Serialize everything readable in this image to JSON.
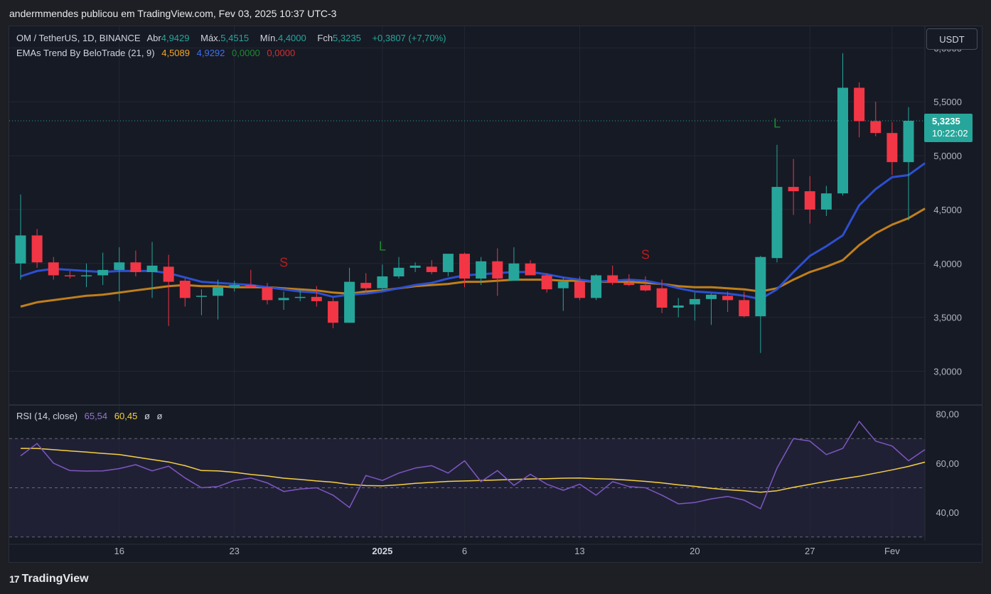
{
  "header": {
    "publish_text": "andermmendes publicou em TradingView.com, Fev 03, 2025 10:37 UTC-3"
  },
  "legend": {
    "symbol": "OM / TetherUS, 1D, BINANCE",
    "open_label": "Abr",
    "open_value": "4,9429",
    "high_label": "Máx.",
    "high_value": "5,4515",
    "low_label": "Mín.",
    "low_value": "4,4000",
    "close_label": "Fch",
    "close_value": "5,3235",
    "change": "+0,3807 (+7,70%)",
    "indicator_name": "EMAs Trend By BeloTrade (21, 9)",
    "ema21_value": "4,5089",
    "ema9_value": "4,9292",
    "val3": "0,0000",
    "val4": "0,0000"
  },
  "rsi_legend": {
    "name": "RSI (14, close)",
    "rsi_value": "65,54",
    "ma_value": "60,45",
    "sym1": "ø",
    "sym2": "ø"
  },
  "currency_button": "USDT",
  "price_label": {
    "price": "5,3235",
    "countdown": "10:22:02"
  },
  "footer": {
    "logo_mark": "17",
    "brand": "TradingView"
  },
  "colors": {
    "up": "#26a69a",
    "down": "#f23645",
    "ema9": "#2d4fcf",
    "ema21": "#c07f1b",
    "rsi": "#7e57c2",
    "rsi_ma": "#f5d142",
    "bg": "#161a25"
  },
  "chart_data": [
    {
      "type": "candlestick",
      "title": "OM / TetherUS, 1D, BINANCE",
      "y_ticks": [
        "6,0000",
        "5,5000",
        "5,0000",
        "4,5000",
        "4,0000",
        "3,5000",
        "3,0000"
      ],
      "y_tick_values": [
        6.0,
        5.5,
        5.0,
        4.5,
        4.0,
        3.5,
        3.0
      ],
      "ylim": [
        2.72,
        6.2
      ],
      "x_ticks": [
        {
          "label": "16",
          "index": 6,
          "bold": false
        },
        {
          "label": "23",
          "index": 13,
          "bold": false
        },
        {
          "label": "2025",
          "index": 22,
          "bold": true
        },
        {
          "label": "6",
          "index": 27,
          "bold": false
        },
        {
          "label": "13",
          "index": 34,
          "bold": false
        },
        {
          "label": "20",
          "index": 41,
          "bold": false
        },
        {
          "label": "27",
          "index": 48,
          "bold": false
        },
        {
          "label": "Fev",
          "index": 53,
          "bold": false
        }
      ],
      "candles": [
        {
          "o": 4.0,
          "h": 4.64,
          "l": 3.85,
          "c": 4.26
        },
        {
          "o": 4.26,
          "h": 4.32,
          "l": 3.96,
          "c": 4.01
        },
        {
          "o": 4.01,
          "h": 4.06,
          "l": 3.85,
          "c": 3.89
        },
        {
          "o": 3.89,
          "h": 3.93,
          "l": 3.86,
          "c": 3.88
        },
        {
          "o": 3.88,
          "h": 4.0,
          "l": 3.78,
          "c": 3.89
        },
        {
          "o": 3.89,
          "h": 4.1,
          "l": 3.8,
          "c": 3.94
        },
        {
          "o": 3.94,
          "h": 4.15,
          "l": 3.65,
          "c": 4.01
        },
        {
          "o": 4.01,
          "h": 4.12,
          "l": 3.88,
          "c": 3.92
        },
        {
          "o": 3.92,
          "h": 4.2,
          "l": 3.68,
          "c": 3.98
        },
        {
          "o": 3.97,
          "h": 4.08,
          "l": 3.42,
          "c": 3.83
        },
        {
          "o": 3.84,
          "h": 3.86,
          "l": 3.6,
          "c": 3.68
        },
        {
          "o": 3.69,
          "h": 3.76,
          "l": 3.52,
          "c": 3.7
        },
        {
          "o": 3.7,
          "h": 3.85,
          "l": 3.48,
          "c": 3.78
        },
        {
          "o": 3.78,
          "h": 3.84,
          "l": 3.74,
          "c": 3.8
        },
        {
          "o": 3.8,
          "h": 3.94,
          "l": 3.77,
          "c": 3.78
        },
        {
          "o": 3.78,
          "h": 3.82,
          "l": 3.62,
          "c": 3.66
        },
        {
          "o": 3.66,
          "h": 3.74,
          "l": 3.57,
          "c": 3.68
        },
        {
          "o": 3.68,
          "h": 3.76,
          "l": 3.65,
          "c": 3.69
        },
        {
          "o": 3.69,
          "h": 3.79,
          "l": 3.6,
          "c": 3.65
        },
        {
          "o": 3.65,
          "h": 3.68,
          "l": 3.4,
          "c": 3.45
        },
        {
          "o": 3.45,
          "h": 3.96,
          "l": 3.45,
          "c": 3.83
        },
        {
          "o": 3.82,
          "h": 3.91,
          "l": 3.73,
          "c": 3.77
        },
        {
          "o": 3.77,
          "h": 3.99,
          "l": 3.75,
          "c": 3.88
        },
        {
          "o": 3.88,
          "h": 4.06,
          "l": 3.86,
          "c": 3.96
        },
        {
          "o": 3.96,
          "h": 4.01,
          "l": 3.92,
          "c": 3.98
        },
        {
          "o": 3.97,
          "h": 4.03,
          "l": 3.9,
          "c": 3.92
        },
        {
          "o": 3.92,
          "h": 4.09,
          "l": 3.88,
          "c": 4.09
        },
        {
          "o": 4.09,
          "h": 4.1,
          "l": 3.78,
          "c": 3.86
        },
        {
          "o": 3.86,
          "h": 4.06,
          "l": 3.8,
          "c": 4.02
        },
        {
          "o": 4.02,
          "h": 4.14,
          "l": 3.7,
          "c": 3.86
        },
        {
          "o": 3.84,
          "h": 4.15,
          "l": 3.84,
          "c": 4.0
        },
        {
          "o": 4.0,
          "h": 4.03,
          "l": 3.89,
          "c": 3.89
        },
        {
          "o": 3.89,
          "h": 3.91,
          "l": 3.73,
          "c": 3.76
        },
        {
          "o": 3.77,
          "h": 3.87,
          "l": 3.56,
          "c": 3.83
        },
        {
          "o": 3.83,
          "h": 3.88,
          "l": 3.66,
          "c": 3.68
        },
        {
          "o": 3.68,
          "h": 3.9,
          "l": 3.66,
          "c": 3.89
        },
        {
          "o": 3.89,
          "h": 3.98,
          "l": 3.8,
          "c": 3.82
        },
        {
          "o": 3.82,
          "h": 3.9,
          "l": 3.79,
          "c": 3.8
        },
        {
          "o": 3.8,
          "h": 3.88,
          "l": 3.74,
          "c": 3.75
        },
        {
          "o": 3.77,
          "h": 3.85,
          "l": 3.54,
          "c": 3.59
        },
        {
          "o": 3.59,
          "h": 3.68,
          "l": 3.5,
          "c": 3.61
        },
        {
          "o": 3.62,
          "h": 3.73,
          "l": 3.47,
          "c": 3.67
        },
        {
          "o": 3.67,
          "h": 3.72,
          "l": 3.43,
          "c": 3.71
        },
        {
          "o": 3.7,
          "h": 3.74,
          "l": 3.55,
          "c": 3.66
        },
        {
          "o": 3.66,
          "h": 3.74,
          "l": 3.5,
          "c": 3.51
        },
        {
          "o": 3.51,
          "h": 4.07,
          "l": 3.17,
          "c": 4.06
        },
        {
          "o": 4.05,
          "h": 5.1,
          "l": 4.01,
          "c": 4.71
        },
        {
          "o": 4.71,
          "h": 4.97,
          "l": 4.45,
          "c": 4.67
        },
        {
          "o": 4.67,
          "h": 4.81,
          "l": 4.37,
          "c": 4.5
        },
        {
          "o": 4.5,
          "h": 4.72,
          "l": 4.44,
          "c": 4.65
        },
        {
          "o": 4.65,
          "h": 5.95,
          "l": 4.63,
          "c": 5.63
        },
        {
          "o": 5.63,
          "h": 5.68,
          "l": 5.17,
          "c": 5.32
        },
        {
          "o": 5.32,
          "h": 5.5,
          "l": 5.18,
          "c": 5.21
        },
        {
          "o": 5.21,
          "h": 5.31,
          "l": 4.82,
          "c": 4.94
        },
        {
          "o": 4.94,
          "h": 5.45,
          "l": 4.4,
          "c": 5.3235
        }
      ],
      "ema9": [
        3.88,
        3.93,
        3.95,
        3.94,
        3.93,
        3.92,
        3.93,
        3.93,
        3.93,
        3.91,
        3.87,
        3.83,
        3.82,
        3.81,
        3.8,
        3.78,
        3.76,
        3.74,
        3.73,
        3.69,
        3.71,
        3.72,
        3.74,
        3.77,
        3.8,
        3.82,
        3.86,
        3.89,
        3.9,
        3.91,
        3.92,
        3.92,
        3.9,
        3.87,
        3.85,
        3.83,
        3.84,
        3.85,
        3.84,
        3.81,
        3.77,
        3.74,
        3.73,
        3.72,
        3.7,
        3.67,
        3.76,
        3.92,
        4.07,
        4.16,
        4.26,
        4.54,
        4.69,
        4.8,
        4.82,
        4.93
      ],
      "ema21": [
        3.6,
        3.64,
        3.66,
        3.68,
        3.7,
        3.71,
        3.73,
        3.75,
        3.77,
        3.79,
        3.8,
        3.79,
        3.79,
        3.78,
        3.78,
        3.78,
        3.77,
        3.76,
        3.75,
        3.73,
        3.72,
        3.74,
        3.75,
        3.77,
        3.79,
        3.8,
        3.81,
        3.83,
        3.83,
        3.84,
        3.85,
        3.85,
        3.85,
        3.84,
        3.84,
        3.83,
        3.83,
        3.83,
        3.82,
        3.81,
        3.79,
        3.78,
        3.78,
        3.77,
        3.76,
        3.74,
        3.77,
        3.85,
        3.92,
        3.97,
        4.03,
        4.17,
        4.28,
        4.36,
        4.42,
        4.5089
      ],
      "signals": [
        {
          "label": "S",
          "index": 16,
          "price": 3.97,
          "color": "#b71c1c"
        },
        {
          "label": "L",
          "index": 22,
          "price": 4.12,
          "color": "#1b8a2f"
        },
        {
          "label": "S",
          "index": 38,
          "price": 4.04,
          "color": "#b71c1c"
        },
        {
          "label": "L",
          "index": 46,
          "price": 5.26,
          "color": "#1b8a2f"
        }
      ],
      "last_price": 5.3235
    },
    {
      "type": "line",
      "title": "RSI (14, close)",
      "y_ticks": [
        "80,00",
        "60,00",
        "40,00"
      ],
      "y_tick_values": [
        80,
        60,
        40
      ],
      "ylim": [
        28.5,
        82.5
      ],
      "bands": [
        70,
        50,
        30
      ],
      "series": [
        {
          "name": "RSI",
          "values": [
            63,
            68,
            60,
            57,
            56.8,
            56.9,
            57.8,
            59.4,
            56.9,
            58.8,
            54,
            50,
            50.5,
            53,
            54,
            52,
            48.5,
            49.5,
            50,
            47,
            42,
            55,
            53,
            56,
            58,
            59,
            56,
            61,
            52.5,
            57,
            51,
            55.5,
            51.5,
            49,
            51.5,
            47,
            52.5,
            50.5,
            50,
            47,
            43.5,
            44,
            45.5,
            46.5,
            45,
            41.5,
            58,
            70,
            69,
            63.5,
            66,
            77,
            69,
            67,
            61,
            65.54
          ]
        },
        {
          "name": "RSI-based MA",
          "values": [
            66,
            66,
            65.5,
            65,
            64.5,
            64,
            63.5,
            62.5,
            61.5,
            60.5,
            59,
            57,
            56.9,
            56.3,
            55.4,
            54.8,
            53.9,
            53.4,
            52.8,
            52.3,
            51.4,
            50.9,
            50.8,
            51.2,
            51.8,
            52.2,
            52.6,
            52.8,
            53,
            53.2,
            53.4,
            53.6,
            53.7,
            53.9,
            54,
            53.7,
            53.5,
            53.1,
            52.6,
            52,
            51.2,
            50.6,
            49.8,
            49.2,
            48.8,
            48.2,
            48.8,
            50.2,
            51.4,
            52.6,
            53.7,
            54.7,
            56,
            57.3,
            58.7,
            60.45
          ]
        }
      ]
    }
  ]
}
